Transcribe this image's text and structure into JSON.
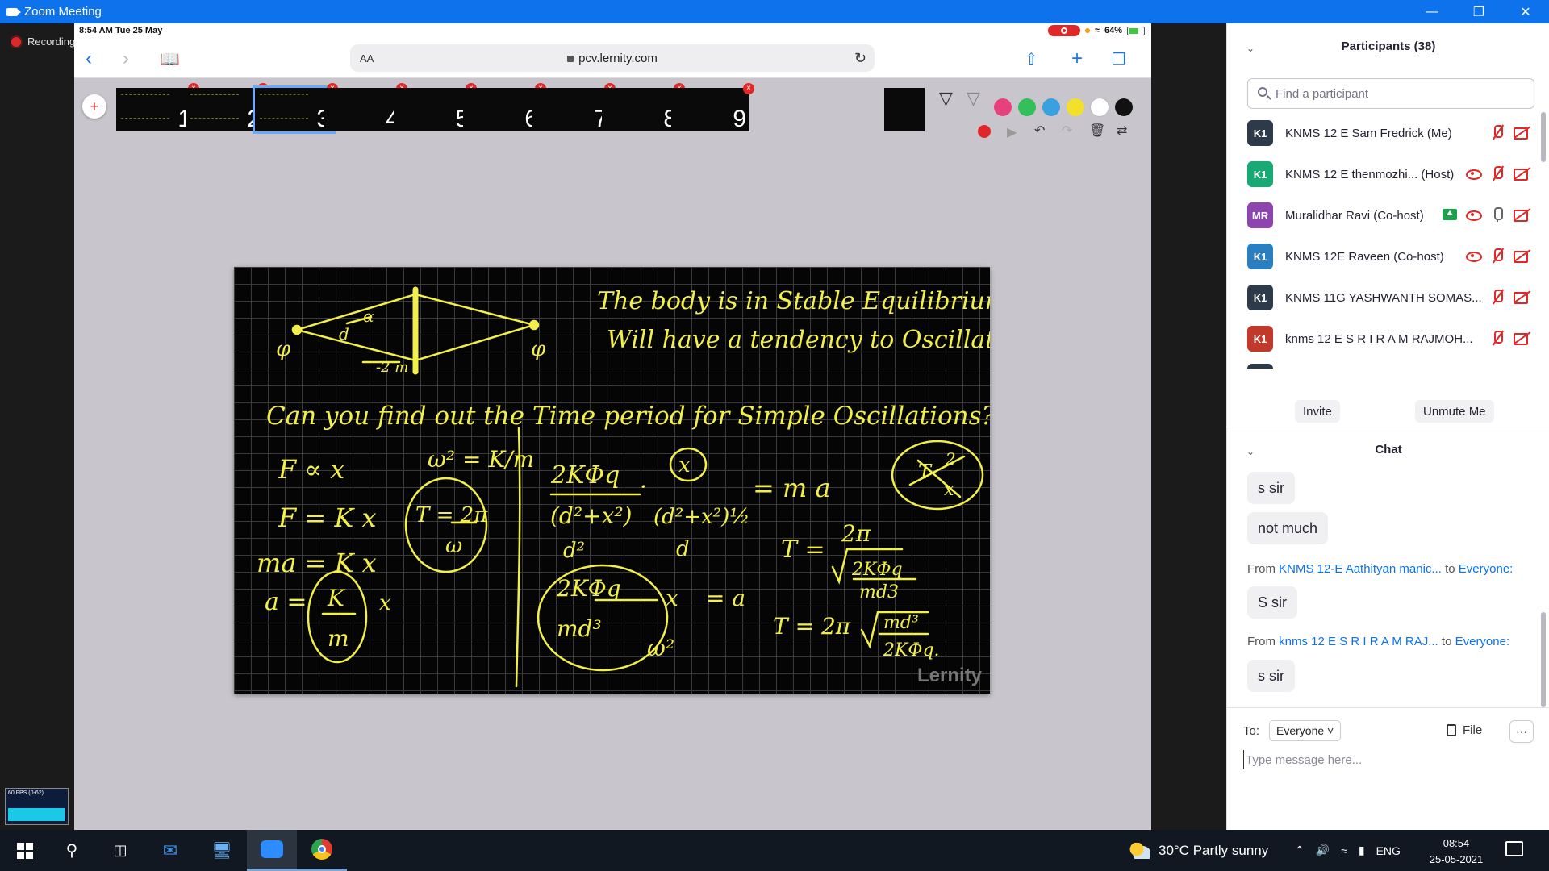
{
  "window": {
    "title": "Zoom Meeting"
  },
  "recording": {
    "label": "Recording..."
  },
  "ipad": {
    "status_time": "8:54 AM   Tue 25 May",
    "battery": "64%",
    "url": "pcv.lernity.com",
    "aa_label": "AA"
  },
  "slides": {
    "numbers": [
      "1",
      "2",
      "3",
      "4",
      "5",
      "6",
      "7",
      "8",
      "9"
    ],
    "active": "3"
  },
  "palette": {
    "colors": [
      "#e8407a",
      "#33c05a",
      "#3aa0e0",
      "#f2e02a",
      "#ffffff",
      "#111111"
    ],
    "record_color": "#e02828"
  },
  "whiteboard": {
    "line1": "The body is in Stable Equilibrium",
    "line2": "Will have a tendency to Oscillate",
    "question": "Can you find out the Time period for Simple Oscillations?",
    "watermark": "Lernity",
    "ink_color": "#f2ef4a"
  },
  "fps": {
    "label": "60 FPS (0-62)"
  },
  "participants": {
    "header": "Participants (38)",
    "search_placeholder": "Find a participant",
    "list": [
      {
        "initials": "K1",
        "name": "KNMS 12 E Sam Fredrick (Me)",
        "color": "#2d3a4a",
        "status": [
          "mic-off",
          "vid-off"
        ]
      },
      {
        "initials": "K1",
        "name": "KNMS 12 E thenmozhi... (Host)",
        "color": "#19a974",
        "status": [
          "eye",
          "mic-off",
          "vid-off"
        ]
      },
      {
        "initials": "MR",
        "name": "Muralidhar Ravi (Co-host)",
        "color": "#8e44ad",
        "status": [
          "share",
          "eye",
          "mic-on",
          "vid-off"
        ]
      },
      {
        "initials": "K1",
        "name": "KNMS 12E Raveen (Co-host)",
        "color": "#2a7fc1",
        "status": [
          "eye",
          "mic-off",
          "vid-off"
        ]
      },
      {
        "initials": "K1",
        "name": "KNMS 11G YASHWANTH SOMAS...",
        "color": "#2d3a4a",
        "status": [
          "mic-off",
          "vid-off"
        ]
      },
      {
        "initials": "K1",
        "name": "knms 12 E  S R I R A M RAJMOH...",
        "color": "#c0392b",
        "status": [
          "mic-off",
          "vid-off"
        ]
      }
    ],
    "invite_label": "Invite",
    "unmute_label": "Unmute Me"
  },
  "chat": {
    "header": "Chat",
    "messages": [
      {
        "text": "s sir"
      },
      {
        "text": "not much"
      },
      {
        "from_prefix": "From ",
        "from": "KNMS 12-E Aathityan manic...",
        "to_prefix": "  to ",
        "to": "Everyone:",
        "text": "S sir"
      },
      {
        "from_prefix": "From ",
        "from": "knms 12 E  S R I R A M RAJ...",
        "to_prefix": "    to ",
        "to": "Everyone:",
        "text": "s sir"
      }
    ],
    "to_label": "To:",
    "to_value": "Everyone",
    "file_label": "File",
    "more_label": "···",
    "input_placeholder": "Type message here..."
  },
  "taskbar": {
    "weather": "30°C  Partly sunny",
    "lang": "ENG",
    "time": "08:54",
    "date": "25-05-2021"
  }
}
